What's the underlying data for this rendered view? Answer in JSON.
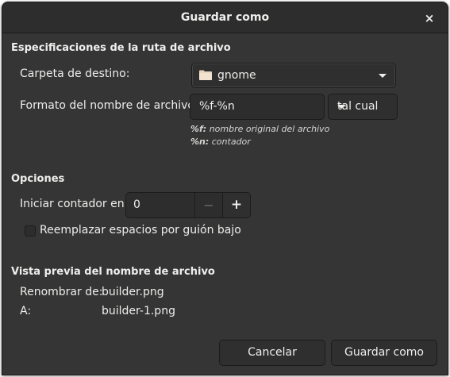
{
  "dialog": {
    "title": "Guardar como",
    "close_glyph": "×"
  },
  "path_section": {
    "title": "Especificaciones de la ruta de archivo",
    "destination_label": "Carpeta de destino:",
    "destination_value": "gnome",
    "format_label": "Formato del nombre de archivo:",
    "format_value": "%f-%n",
    "case_value": "tal cual",
    "hint_f_key": "%f:",
    "hint_f_text": " nombre original del archivo",
    "hint_n_key": "%n:",
    "hint_n_text": " contador"
  },
  "options_section": {
    "title": "Opciones",
    "counter_label": "Iniciar contador en:",
    "counter_value": "0",
    "minus_glyph": "−",
    "plus_glyph": "+",
    "replace_spaces_label": "Reemplazar espacios por guión bajo",
    "replace_spaces_checked": false
  },
  "preview_section": {
    "title": "Vista previa del nombre de archivo",
    "rename_from_label": "Renombrar de:",
    "rename_from_value": "builder.png",
    "to_label": "A:",
    "to_value": "builder-1.png"
  },
  "actions": {
    "cancel_label": "Cancelar",
    "save_label": "Guardar como"
  },
  "colors": {
    "window_bg": "#353535",
    "headerbar_bg": "#2d2d2d",
    "text": "#eeeeec",
    "border": "#1b1b1b",
    "folder_icon": "#e8d6bd"
  }
}
